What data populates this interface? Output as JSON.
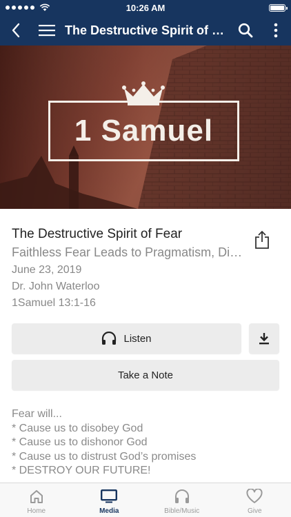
{
  "status_bar": {
    "time": "10:26 AM"
  },
  "nav": {
    "title": "The Destructive Spirit of Fear"
  },
  "hero": {
    "title": "1 Samuel"
  },
  "sermon": {
    "title": "The Destructive Spirit of Fear",
    "subtitle": "Faithless Fear Leads to Pragmatism, Disobedience",
    "date": "June 23, 2019",
    "speaker": "Dr. John Waterloo",
    "scripture": "1Samuel 13:1-16"
  },
  "actions": {
    "listen_label": "Listen",
    "note_label": "Take a Note"
  },
  "description": {
    "lines": [
      "Fear will...",
      "* Cause us to disobey God",
      "* Cause us to dishonor God",
      "* Cause us to distrust God’s promises",
      "* DESTROY OUR FUTURE!"
    ]
  },
  "tabs": [
    {
      "label": "Home",
      "icon": "home-icon",
      "active": false
    },
    {
      "label": "Media",
      "icon": "tv-icon",
      "active": true
    },
    {
      "label": "Bible/Music",
      "icon": "headphones-icon",
      "active": false
    },
    {
      "label": "Give",
      "icon": "heart-icon",
      "active": false
    }
  ],
  "colors": {
    "nav_bg": "#17355f",
    "accent": "#17355f",
    "muted_text": "#888888",
    "button_bg": "#ececec"
  }
}
